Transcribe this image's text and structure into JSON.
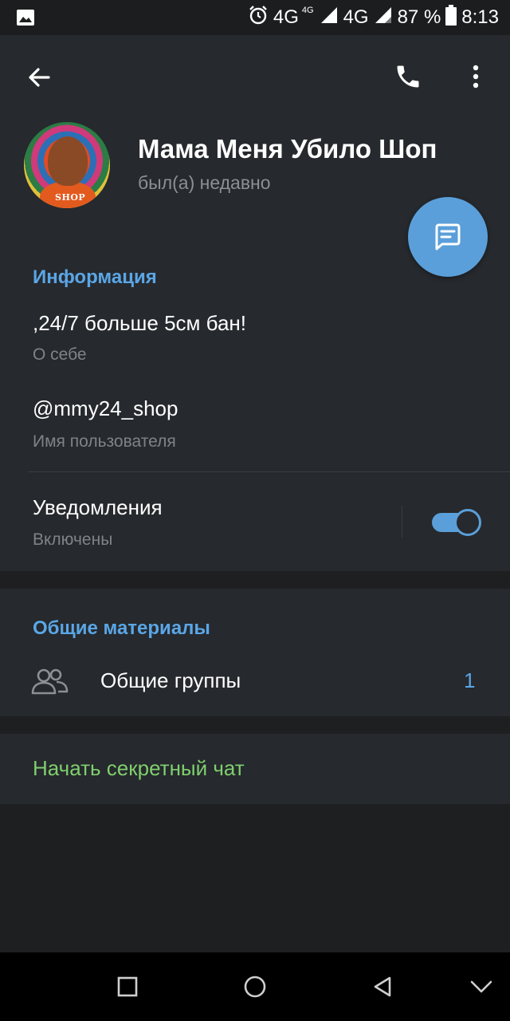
{
  "status_bar": {
    "network_1": "4G",
    "network_1_sup": "4G",
    "network_2": "4G",
    "battery": "87 %",
    "time": "8:13"
  },
  "header": {
    "title": "Мама Меня Убило Шоп",
    "subtitle": "был(а) недавно",
    "avatar_text": "SHOP"
  },
  "info": {
    "section_title": "Информация",
    "bio_value": ",24/7 больше 5см бан!",
    "bio_label": "О себе",
    "username_value": "@mmy24_shop",
    "username_label": "Имя пользователя",
    "notifications_title": "Уведомления",
    "notifications_status": "Включены",
    "notifications_on": true
  },
  "shared": {
    "section_title": "Общие материалы",
    "groups_label": "Общие группы",
    "groups_count": "1"
  },
  "secret_chat": {
    "label": "Начать секретный чат"
  },
  "colors": {
    "accent": "#5a9fd9",
    "section_title": "#5aa6e6",
    "secret": "#7fcf6e",
    "background": "#1d1f21",
    "card": "#26292d"
  },
  "icons": {
    "status_left": "image-icon",
    "alarm": "alarm-icon",
    "back": "arrow-left-icon",
    "call": "phone-icon",
    "menu": "more-vertical-icon",
    "fab": "message-icon",
    "groups": "people-icon",
    "nav": [
      "square-icon",
      "circle-icon",
      "triangle-back-icon",
      "chevron-down-icon"
    ]
  }
}
